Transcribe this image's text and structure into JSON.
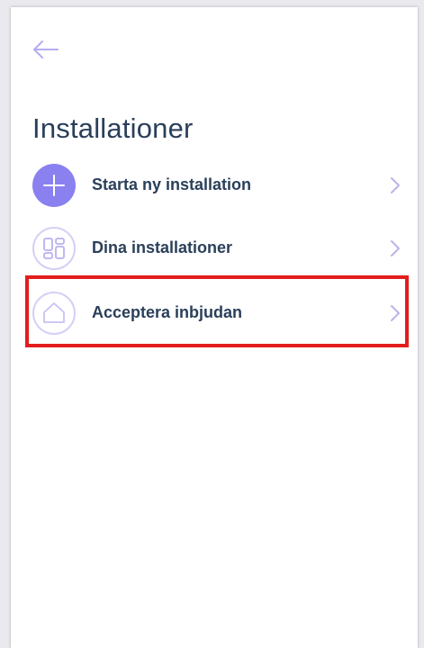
{
  "header": {
    "back_icon": "arrow-left-icon",
    "title": "Installationer"
  },
  "menu": {
    "items": [
      {
        "label": "Starta ny installation",
        "icon": "plus-icon"
      },
      {
        "label": "Dina installationer",
        "icon": "grid-icon"
      },
      {
        "label": "Acceptera inbjudan",
        "icon": "home-icon"
      }
    ],
    "chevron_icon": "chevron-right-icon",
    "highlighted_item": "Acceptera inbjudan"
  },
  "colors": {
    "accent": "#8a80f0",
    "text": "#2a3f5a",
    "highlight": "#e21d1d"
  }
}
